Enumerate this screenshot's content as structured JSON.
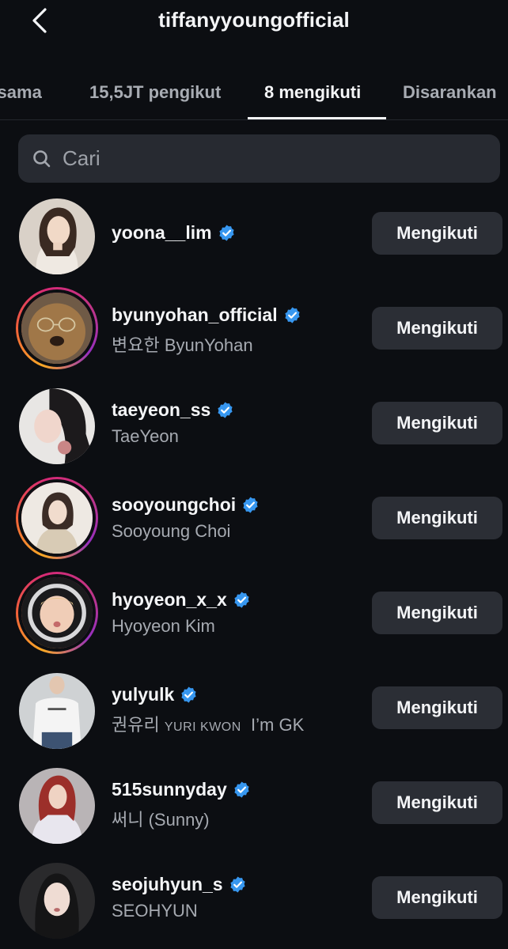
{
  "header": {
    "title": "tiffanyyoungofficial"
  },
  "tabs": [
    {
      "label": "rsama"
    },
    {
      "label": "15,5JT pengikut"
    },
    {
      "label": "8 mengikuti"
    },
    {
      "label": "Disarankan"
    }
  ],
  "active_tab": "8 mengikuti",
  "search": {
    "placeholder": "Cari",
    "value": ""
  },
  "colors": {
    "background": "#0c0e12",
    "button_bg": "#2b2e35",
    "verified_blue": "#3797f0",
    "secondary_text": "#a6aab1"
  },
  "following": [
    {
      "username": "yoona__lim",
      "full_name": "",
      "verified": true,
      "story_ring": false,
      "button": "Mengikuti"
    },
    {
      "username": "byunyohan_official",
      "full_name": "변요한 ByunYohan",
      "verified": true,
      "story_ring": true,
      "button": "Mengikuti"
    },
    {
      "username": "taeyeon_ss",
      "full_name": "TaeYeon",
      "verified": true,
      "story_ring": false,
      "button": "Mengikuti"
    },
    {
      "username": "sooyoungchoi",
      "full_name": "Sooyoung Choi",
      "verified": true,
      "story_ring": true,
      "button": "Mengikuti"
    },
    {
      "username": "hyoyeon_x_x",
      "full_name": "Hyoyeon Kim",
      "verified": true,
      "story_ring": true,
      "button": "Mengikuti"
    },
    {
      "username": "yulyulk",
      "full_name": "권유리",
      "full_name_caps": "YURI KWON",
      "full_name_tail": "I’m GK",
      "verified": true,
      "story_ring": false,
      "button": "Mengikuti"
    },
    {
      "username": "515sunnyday",
      "full_name": "써니 (Sunny)",
      "verified": true,
      "story_ring": false,
      "button": "Mengikuti"
    },
    {
      "username": "seojuhyun_s",
      "full_name": "SEOHYUN",
      "verified": true,
      "story_ring": false,
      "button": "Mengikuti"
    }
  ]
}
